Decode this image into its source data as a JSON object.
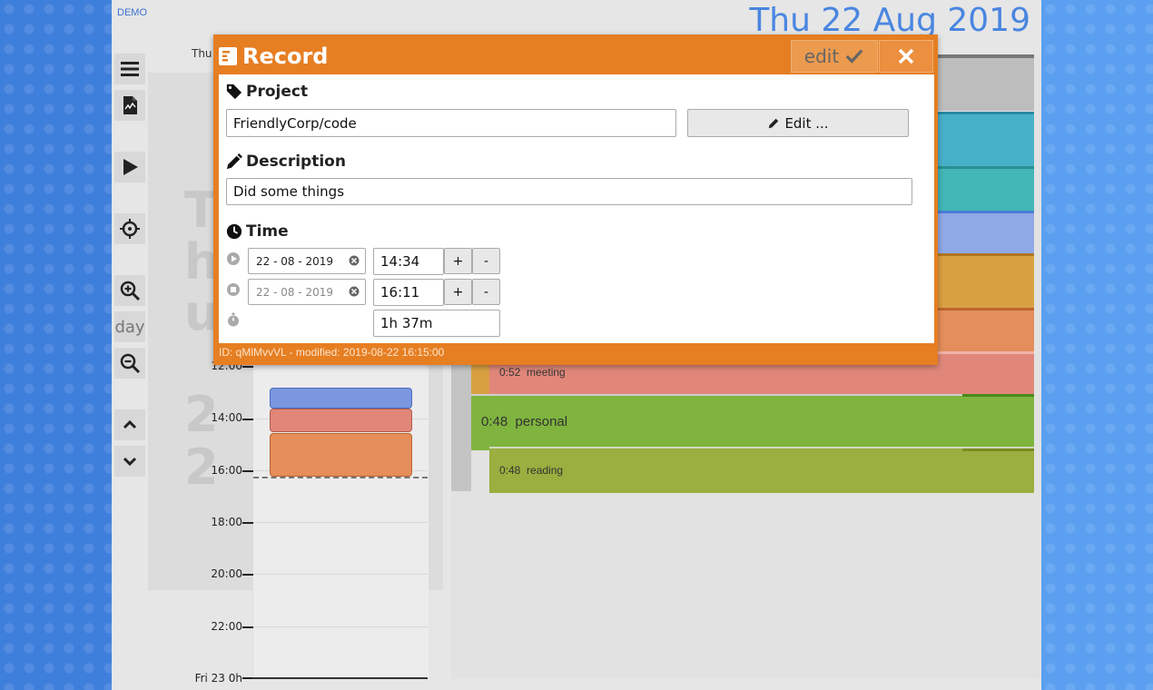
{
  "app": {
    "demo_label": "DEMO",
    "date_heading": "Thu 22 Aug 2019",
    "weekday_short": "Thu",
    "zoom_level_label": "day",
    "vertical_letters": [
      "T",
      "h",
      "u",
      "2",
      "2"
    ]
  },
  "timeline": {
    "hours": [
      "12:00",
      "14:00",
      "16:00",
      "18:00",
      "20:00",
      "22:00",
      "Fri 23 0h"
    ]
  },
  "summary": {
    "items": [
      {
        "time": "0:52",
        "name": "meeting",
        "color": "#e0877a"
      },
      {
        "time": "0:48",
        "name": "personal",
        "color": "#7fb43f"
      },
      {
        "time": "0:48",
        "name": "reading",
        "color": "#9aaf3f"
      }
    ]
  },
  "modal": {
    "title": "Record",
    "edit_label": "edit",
    "project_heading": "Project",
    "project_value": "FriendlyCorp/code",
    "edit_project_label": "Edit ...",
    "description_heading": "Description",
    "description_value": "Did some things",
    "time_heading": "Time",
    "start_date": "22 - 08 - 2019",
    "start_time": "14:34",
    "end_date": "22 - 08 - 2019",
    "end_time": "16:11",
    "duration": "1h 37m",
    "plus_label": "+",
    "minus_label": "-",
    "footer": "ID: qMlMvvVL - modified: 2019-08-22 16:15:00"
  },
  "colors": {
    "modal_accent": "#e67e22",
    "background": "#3f7fdc",
    "date_heading": "#4a86e0"
  }
}
